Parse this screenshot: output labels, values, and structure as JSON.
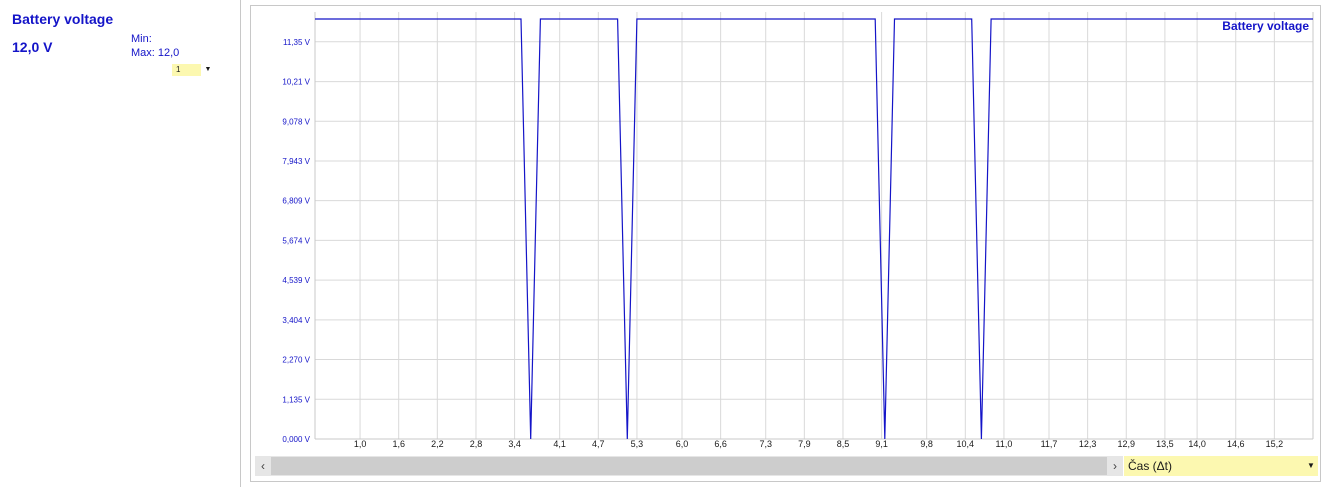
{
  "sensor_panel": {
    "title": "Battery voltage",
    "value": "12,0 V",
    "min_label": "Min:",
    "max_label": "Max: 12,0",
    "step_select": "1"
  },
  "x_axis_select": {
    "value": "Čas (Δt)"
  },
  "colors": {
    "series": "#1414c8",
    "grid": "#d9d9d9",
    "select_bg": "#fcf8b0"
  },
  "chart_data": {
    "type": "line",
    "title": "",
    "xlabel": "",
    "ylabel": "",
    "legend_position": "top-right",
    "grid": true,
    "ylim": [
      0,
      12.2
    ],
    "xlim": [
      0.3,
      15.8
    ],
    "y_tick_labels": [
      "0,000 V",
      "1,135 V",
      "2,270 V",
      "3,404 V",
      "4,539 V",
      "5,674 V",
      "6,809 V",
      "7,943 V",
      "9,078 V",
      "10,21 V",
      "11,35 V"
    ],
    "y_tick_values": [
      0,
      1.135,
      2.27,
      3.404,
      4.539,
      5.674,
      6.809,
      7.943,
      9.078,
      10.21,
      11.35
    ],
    "x_tick_labels": [
      "1,0",
      "1,6",
      "2,2",
      "2,8",
      "3,4",
      "4,1",
      "4,7",
      "5,3",
      "6,0",
      "6,6",
      "7,3",
      "7,9",
      "8,5",
      "9,1",
      "9,8",
      "10,4",
      "11,0",
      "11,7",
      "12,3",
      "12,9",
      "13,5",
      "14,0",
      "14,6",
      "15,2"
    ],
    "x_tick_values": [
      1.0,
      1.6,
      2.2,
      2.8,
      3.4,
      4.1,
      4.7,
      5.3,
      6.0,
      6.6,
      7.3,
      7.9,
      8.5,
      9.1,
      9.8,
      10.4,
      11.0,
      11.7,
      12.3,
      12.9,
      13.5,
      14.0,
      14.6,
      15.2
    ],
    "series": [
      {
        "name": "Battery voltage",
        "x": [
          0.3,
          3.5,
          3.65,
          3.8,
          5.0,
          5.15,
          5.3,
          9.0,
          9.15,
          9.3,
          10.5,
          10.65,
          10.8,
          15.8
        ],
        "y": [
          12.0,
          12.0,
          0,
          12.0,
          12.0,
          0,
          12.0,
          12.0,
          0,
          12.0,
          12.0,
          0,
          12.0,
          12.0
        ]
      }
    ]
  }
}
